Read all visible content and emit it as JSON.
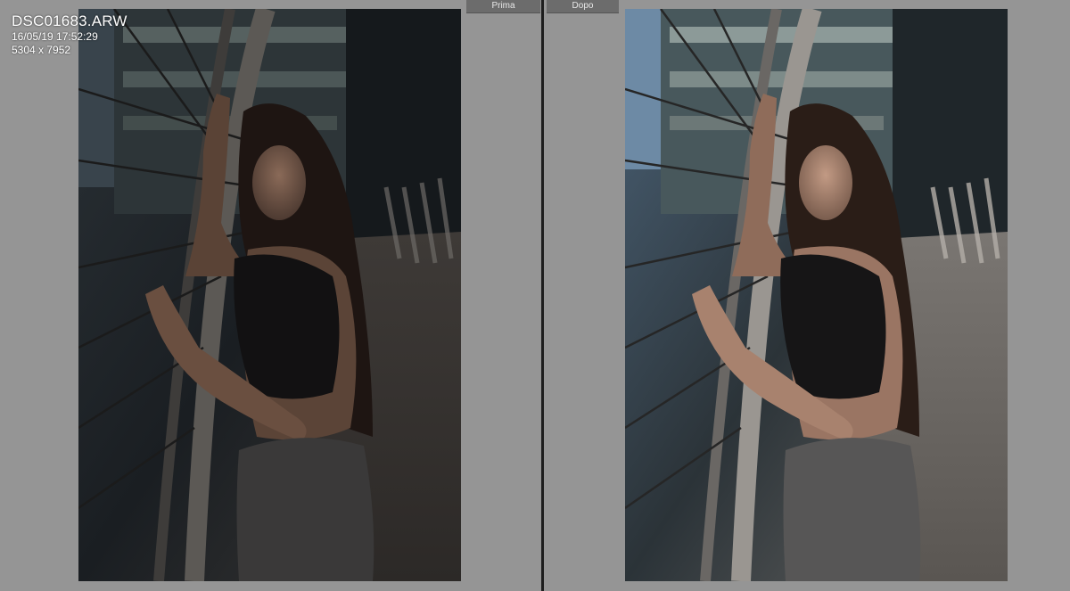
{
  "compare": {
    "before_label": "Prima",
    "after_label": "Dopo"
  },
  "info": {
    "filename": "DSC01683.ARW",
    "datetime": "16/05/19 17:52:29",
    "dimensions": "5304 x 7952"
  },
  "colors": {
    "background": "#959595",
    "divider": "#1e1e1e",
    "tab": "#6c6c6c"
  }
}
